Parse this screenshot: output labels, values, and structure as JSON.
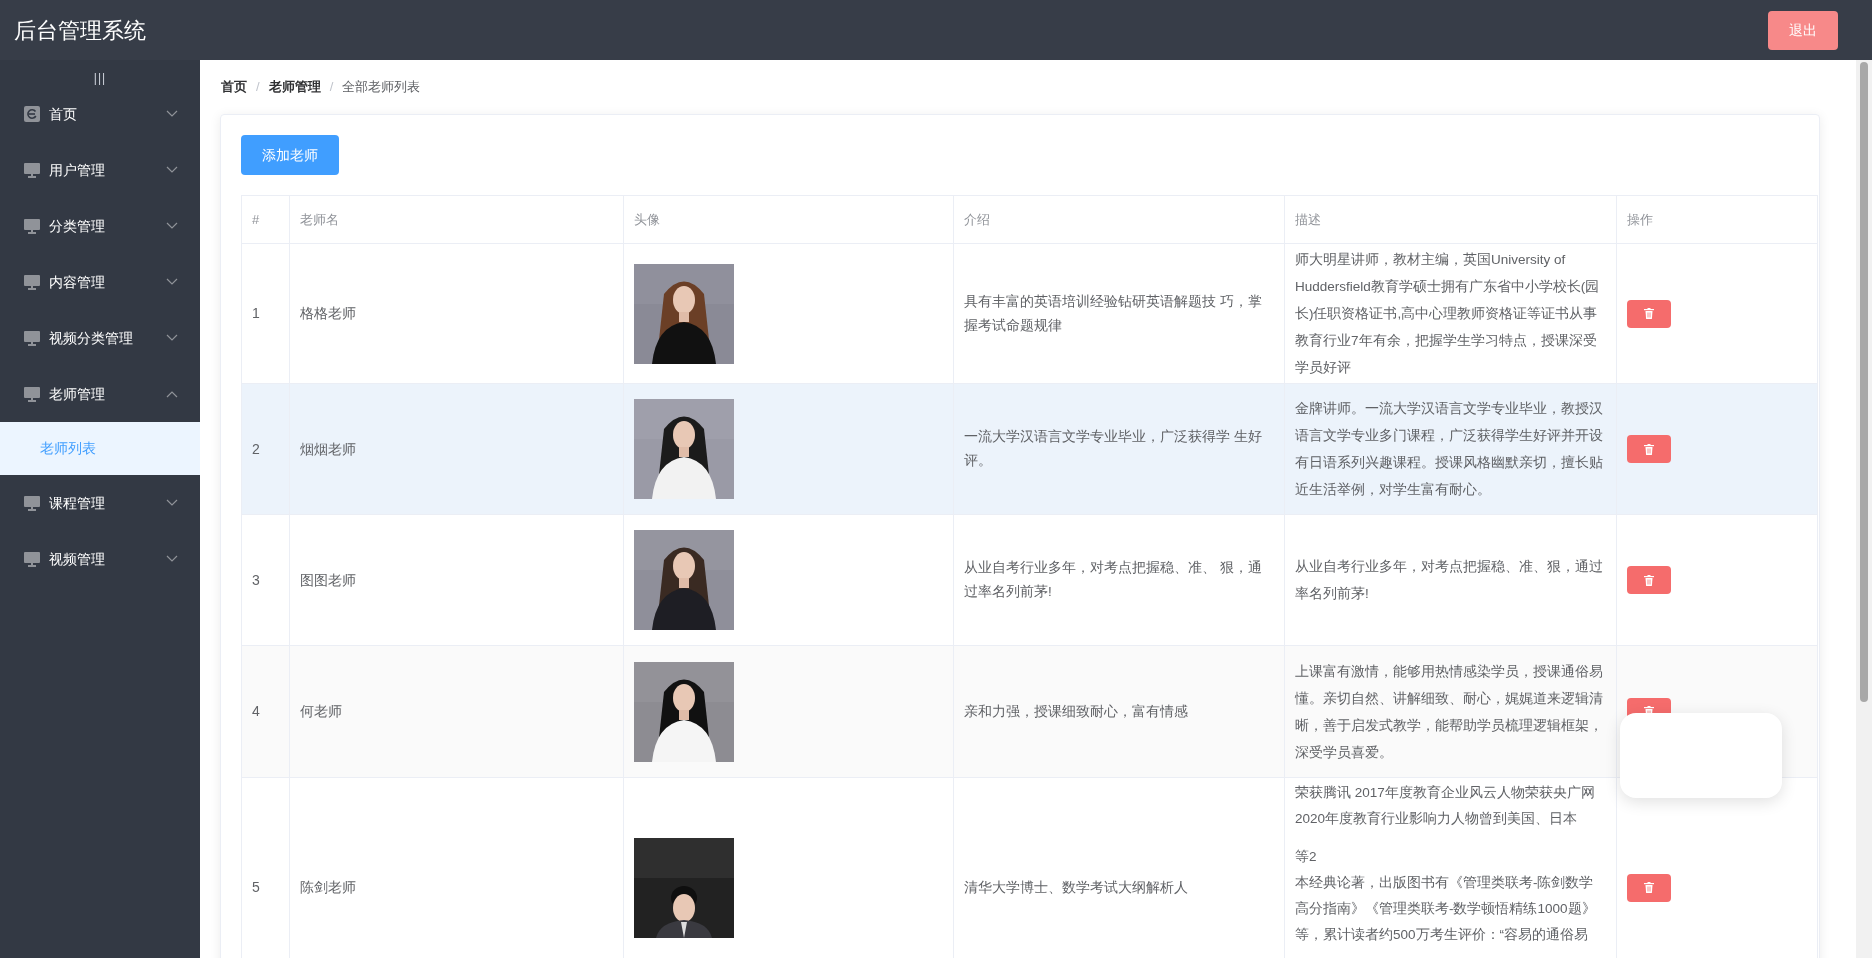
{
  "header": {
    "title": "后台管理系统",
    "logout": "退出"
  },
  "sidebar": {
    "toggle": "|||",
    "items": [
      {
        "label": "首页",
        "expanded": false
      },
      {
        "label": "用户管理",
        "expanded": false
      },
      {
        "label": "分类管理",
        "expanded": false
      },
      {
        "label": "内容管理",
        "expanded": false
      },
      {
        "label": "视频分类管理",
        "expanded": false
      },
      {
        "label": "老师管理",
        "expanded": true,
        "children": [
          {
            "label": "老师列表",
            "selected": true
          }
        ]
      },
      {
        "label": "课程管理",
        "expanded": false
      },
      {
        "label": "视频管理",
        "expanded": false
      }
    ]
  },
  "breadcrumb": {
    "separator": "/",
    "items": [
      {
        "label": "首页",
        "current": false
      },
      {
        "label": "老师管理",
        "current": false
      },
      {
        "label": "全部老师列表",
        "current": true
      }
    ]
  },
  "add_button": "添加老师",
  "table": {
    "columns": [
      "#",
      "老师名",
      "头像",
      "介绍",
      "描述",
      "操作"
    ],
    "rows": [
      {
        "index": "1",
        "name": "格格老师",
        "intro": "具有丰富的英语培训经验钻研英语解题技 巧，掌握考试命题规律",
        "description": [
          "师大明星讲师，教材主编，英国University of Huddersfield教育学硕士拥有广东省中小学校长(园长)任职资格证书,高中心理教师资格证等证书从事教育行业7年有余，把握学生学习特点，授课深受学员好评"
        ],
        "hovered": false
      },
      {
        "index": "2",
        "name": "烟烟老师",
        "intro": "一流大学汉语言文学专业毕业，广泛获得学 生好评。",
        "description": [
          "金牌讲师。一流大学汉语言文学专业毕业，教授汉语言文学专业多门课程，广泛获得学生好评并开设有日语系列兴趣课程。授课风格幽默亲切，擅长贴近生活举例，对学生富有耐心。"
        ],
        "hovered": true
      },
      {
        "index": "3",
        "name": "图图老师",
        "intro": "从业自考行业多年，对考点把握稳、准、 狠，通过率名列前茅!",
        "description": [
          "从业自考行业多年，对考点把握稳、准、狠，通过率名列前茅!"
        ],
        "hovered": false
      },
      {
        "index": "4",
        "name": "何老师",
        "intro": "亲和力强，授课细致耐心，富有情感",
        "description": [
          "上课富有激情，能够用热情感染学员，授课通俗易懂。亲切自然、讲解细致、耐心，娓娓道来逻辑清晰，善于启发式教学，能帮助学员梳理逻辑框架，深受学员喜爱。"
        ],
        "hovered": false
      },
      {
        "index": "5",
        "name": "陈剑老师",
        "intro": "清华大学博士、数学考试大纲解析人",
        "description": [
          "荣获腾讯 2017年度教育企业风云人物荣获央广网",
          "2020年度教育行业影响力人物曾到美国、日本",
          "等2",
          "本经典论著，出版图书有《管理类联考-陈剑数学",
          "高分指南》《管理类联考-数学顿悟精练1000题》",
          "等，累计读者约500万考生评价：“容易的通俗易"
        ],
        "hovered": false
      }
    ]
  },
  "popup": {
    "visible": true
  }
}
